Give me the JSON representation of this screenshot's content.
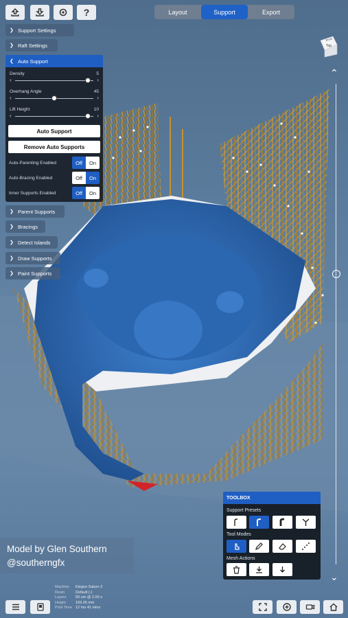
{
  "tabs": [
    {
      "label": "Layout",
      "active": false
    },
    {
      "label": "Support",
      "active": true
    },
    {
      "label": "Export",
      "active": false
    }
  ],
  "top_icons": [
    "upload-icon",
    "download-icon",
    "settings-icon",
    "help-icon"
  ],
  "help_glyph": "?",
  "sections": {
    "support_settings": "Support Settings",
    "raft_settings": "Raft Settings",
    "auto_support": "Auto Support",
    "parent_supports": "Parent Supports",
    "bracings": "Bracings",
    "detect_islands": "Detect Islands",
    "draw_supports": "Draw Supports",
    "paint_supports": "Paint Supports"
  },
  "auto_support": {
    "density": {
      "label": "Density",
      "value": "5",
      "fraction": 0.93
    },
    "overhang": {
      "label": "Overhang Angle",
      "value": "45",
      "fraction": 0.5
    },
    "lift": {
      "label": "Lift Height",
      "value": "10",
      "fraction": 0.93
    },
    "auto_support_button": "Auto Support",
    "remove_button": "Remove Auto Supports",
    "toggles": [
      {
        "label": "Auto-Parenting Enabled",
        "off": "Off",
        "on": "On",
        "state": "off"
      },
      {
        "label": "Auto-Bracing Enabled",
        "off": "Off",
        "on": "On",
        "state": "on"
      },
      {
        "label": "Inner Supports Enabled",
        "off": "Off",
        "on": "On",
        "state": "off"
      }
    ]
  },
  "view_cube": {
    "face": "Top",
    "edge": "Front"
  },
  "toolbox": {
    "title": "TOOLBOX",
    "support_presets_label": "Support Presets",
    "tool_modes_label": "Tool Modes",
    "mesh_actions_label": "Mesh Actions"
  },
  "credit": {
    "line1": "Model by Glen Southern",
    "line2": "@southerngfx"
  },
  "stats": [
    {
      "key": "Machine",
      "value": "Elegoo Saturn 2"
    },
    {
      "key": "Resin",
      "value": "Default (-)"
    },
    {
      "key": "Layers",
      "value": "50 um @ 2.00 s"
    },
    {
      "key": "Height",
      "value": "169.26 mm"
    },
    {
      "key": "Print Time",
      "value": "12 hrs 41 mins"
    }
  ],
  "colors": {
    "accent": "#1f5fc4",
    "model": "#2f6bb5",
    "supports": "#c8922a",
    "raft": "#e8eaee"
  }
}
